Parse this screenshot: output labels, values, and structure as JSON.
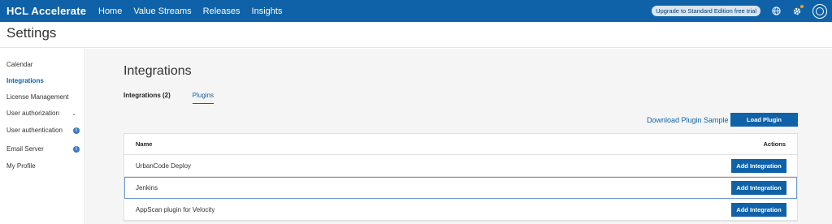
{
  "app": {
    "brand": "HCL Accelerate",
    "nav": [
      "Home",
      "Value Streams",
      "Releases",
      "Insights"
    ],
    "upgrade_label": "Upgrade to Standard Edition free trial",
    "icons": [
      "globe-icon",
      "gear-icon",
      "user-avatar-icon"
    ]
  },
  "page": {
    "title": "Settings"
  },
  "sidebar": {
    "items": [
      {
        "label": "Calendar"
      },
      {
        "label": "Integrations"
      },
      {
        "label": "License Management"
      },
      {
        "label": "User authorization"
      },
      {
        "label": "User authentication"
      },
      {
        "label": "Email Server"
      },
      {
        "label": "My Profile"
      }
    ]
  },
  "main": {
    "heading": "Integrations",
    "tabs": [
      {
        "label": "Integrations (2)"
      },
      {
        "label": "Plugins"
      }
    ],
    "download_label": "Download Plugin Sample",
    "load_label": "Load Plugin",
    "table": {
      "col_name": "Name",
      "col_actions": "Actions",
      "rows": [
        {
          "name": "UrbanCode Deploy",
          "action": "Add Integration"
        },
        {
          "name": "Jenkins",
          "action": "Add Integration"
        },
        {
          "name": "AppScan plugin for Velocity",
          "action": "Add Integration"
        }
      ]
    }
  },
  "colors": {
    "brand_blue": "#0f62a8",
    "background": "#f5f5f5"
  }
}
